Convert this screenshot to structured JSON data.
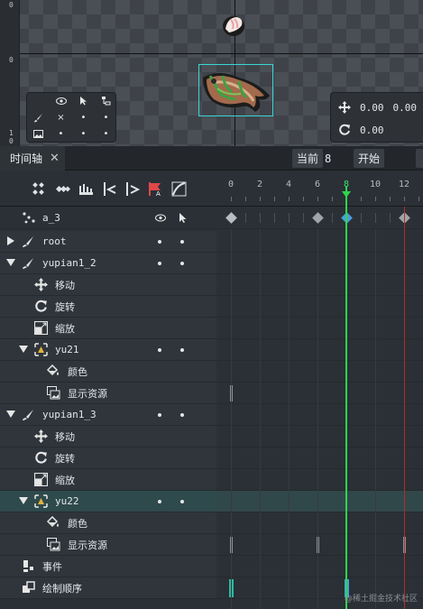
{
  "viewport": {
    "ruler_labels": [
      "0",
      "0",
      "1",
      "0"
    ],
    "visibility_panel": {
      "header_icons": [
        "eye-icon",
        "cursor-icon",
        "bone-tree-icon"
      ],
      "rows": [
        {
          "row_icon": "brush-icon",
          "cells": [
            "×",
            "•",
            "•"
          ]
        },
        {
          "row_icon": "image-icon",
          "cells": [
            "•",
            "•",
            "•"
          ]
        }
      ]
    },
    "transform_panel": {
      "position_value": "0.00",
      "position_value2": "0.00",
      "rotation_value": "0.00"
    }
  },
  "tabbar": {
    "tab_label": "时间轴",
    "current_label": "当前",
    "current_frame": "8",
    "start_label": "开始"
  },
  "toolbar": {
    "tools": [
      "keyframe-scatter-icon",
      "double-diamond-icon",
      "step-icon",
      "prev-key-icon",
      "next-key-icon",
      "auto-key-icon",
      "curve-icon"
    ]
  },
  "ruler": {
    "frames": [
      "0",
      "2",
      "4",
      "6",
      "8",
      "10",
      "12"
    ],
    "current": "8"
  },
  "rows": [
    {
      "label": "a_3",
      "type": "animation"
    },
    {
      "label": "root",
      "type": "bone"
    },
    {
      "label": "yupian1_2",
      "type": "bone"
    },
    {
      "label": "移动",
      "type": "property"
    },
    {
      "label": "旋转",
      "type": "property"
    },
    {
      "label": "缩放",
      "type": "property"
    },
    {
      "label": "yu21",
      "type": "slot"
    },
    {
      "label": "颜色",
      "type": "property"
    },
    {
      "label": "显示资源",
      "type": "property"
    },
    {
      "label": "yupian1_3",
      "type": "bone"
    },
    {
      "label": "移动",
      "type": "property"
    },
    {
      "label": "旋转",
      "type": "property"
    },
    {
      "label": "缩放",
      "type": "property"
    },
    {
      "label": "yu22",
      "type": "slot"
    },
    {
      "label": "颜色",
      "type": "property"
    },
    {
      "label": "显示资源",
      "type": "property"
    },
    {
      "label": "事件",
      "type": "events"
    },
    {
      "label": "绘制顺序",
      "type": "draworder"
    }
  ],
  "watermark": "@稀土掘金技术社区",
  "colors": {
    "playhead": "#2ed64a",
    "selected_row": "#2e4a4c",
    "end_marker": "#b12d2d",
    "selected_key": "#4a9de0"
  }
}
